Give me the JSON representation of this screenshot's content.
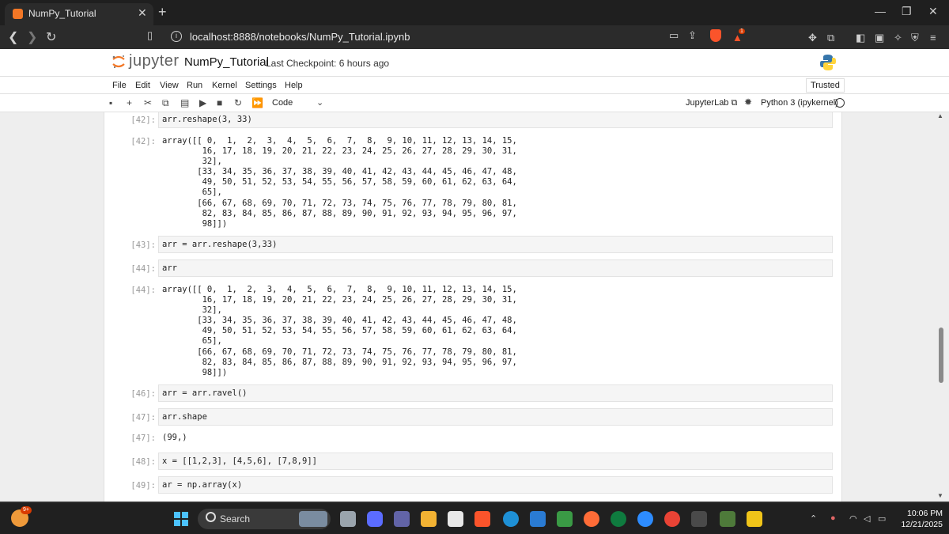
{
  "browser": {
    "tab_title": "NumPy_Tutorial",
    "new_tab": "+",
    "url": "localhost:8888/notebooks/NumPy_Tutorial.ipynb",
    "notification_count": "1"
  },
  "jupyter": {
    "logo_text": "jupyter",
    "notebook_name": "NumPy_Tutorial",
    "checkpoint": "Last Checkpoint: 6 hours ago",
    "menu": [
      "File",
      "Edit",
      "View",
      "Run",
      "Kernel",
      "Settings",
      "Help"
    ],
    "trusted": "Trusted",
    "cell_type": "Code",
    "jupyterlab_link": "JupyterLab",
    "kernel_name": "Python 3 (ipykernel)"
  },
  "cells": [
    {
      "prompt": "[42]:",
      "code": "arr.reshape(3, 33)",
      "out_prompt": "[42]:",
      "output": "array([[ 0,  1,  2,  3,  4,  5,  6,  7,  8,  9, 10, 11, 12, 13, 14, 15,\n        16, 17, 18, 19, 20, 21, 22, 23, 24, 25, 26, 27, 28, 29, 30, 31,\n        32],\n       [33, 34, 35, 36, 37, 38, 39, 40, 41, 42, 43, 44, 45, 46, 47, 48,\n        49, 50, 51, 52, 53, 54, 55, 56, 57, 58, 59, 60, 61, 62, 63, 64,\n        65],\n       [66, 67, 68, 69, 70, 71, 72, 73, 74, 75, 76, 77, 78, 79, 80, 81,\n        82, 83, 84, 85, 86, 87, 88, 89, 90, 91, 92, 93, 94, 95, 96, 97,\n        98]])"
    },
    {
      "prompt": "[43]:",
      "code": "arr = arr.reshape(3,33)"
    },
    {
      "prompt": "[44]:",
      "code": "arr",
      "out_prompt": "[44]:",
      "output": "array([[ 0,  1,  2,  3,  4,  5,  6,  7,  8,  9, 10, 11, 12, 13, 14, 15,\n        16, 17, 18, 19, 20, 21, 22, 23, 24, 25, 26, 27, 28, 29, 30, 31,\n        32],\n       [33, 34, 35, 36, 37, 38, 39, 40, 41, 42, 43, 44, 45, 46, 47, 48,\n        49, 50, 51, 52, 53, 54, 55, 56, 57, 58, 59, 60, 61, 62, 63, 64,\n        65],\n       [66, 67, 68, 69, 70, 71, 72, 73, 74, 75, 76, 77, 78, 79, 80, 81,\n        82, 83, 84, 85, 86, 87, 88, 89, 90, 91, 92, 93, 94, 95, 96, 97,\n        98]])"
    },
    {
      "prompt": "[46]:",
      "code": "arr = arr.ravel()"
    },
    {
      "prompt": "[47]:",
      "code": "arr.shape",
      "out_prompt": "[47]:",
      "output": "(99,)"
    },
    {
      "prompt": "[48]:",
      "code": "x = [[1,2,3], [4,5,6], [7,8,9]]"
    },
    {
      "prompt": "[49]:",
      "code": "ar = np.array(x)"
    }
  ],
  "taskbar": {
    "weather_badge": "9+",
    "search_label": "Search",
    "time": "10:06 PM",
    "date": "12/21/2025"
  },
  "colors": {
    "jupyter_orange": "#f37726",
    "brave_orange": "#fb542b",
    "windows_blue": "#4cc2ff"
  }
}
